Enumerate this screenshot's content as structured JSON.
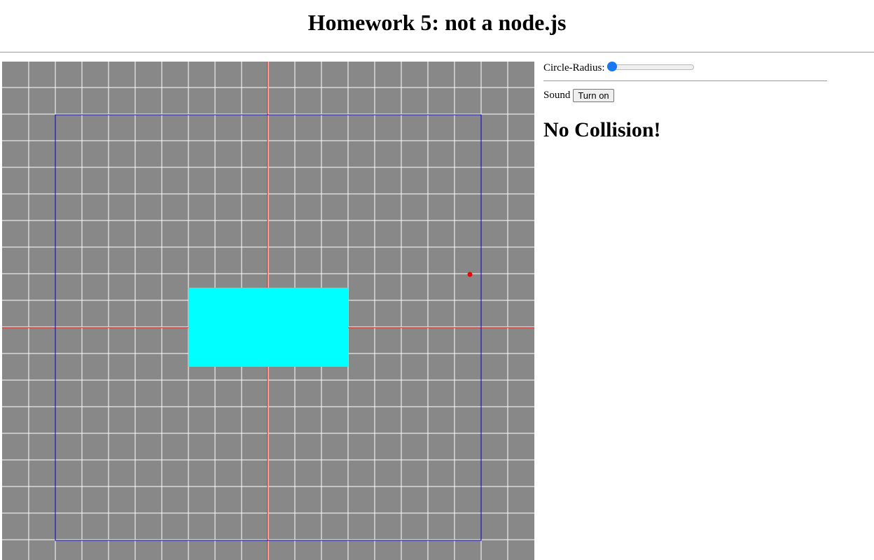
{
  "page": {
    "title": "Homework 5: not a node.js"
  },
  "controls": {
    "radius_label": "Circle-Radius:",
    "radius_value": 0,
    "radius_min": 0,
    "radius_max": 100,
    "sound_label": "Sound",
    "sound_button": "Turn on",
    "status": "No Collision!"
  },
  "scene": {
    "background_color": "#888888",
    "grid_color": "#ffffff",
    "axis_color": "#ff0000",
    "boundary_color": "#0000cc",
    "rectangle_color": "#00ffff",
    "point_color": "#ee0000"
  }
}
